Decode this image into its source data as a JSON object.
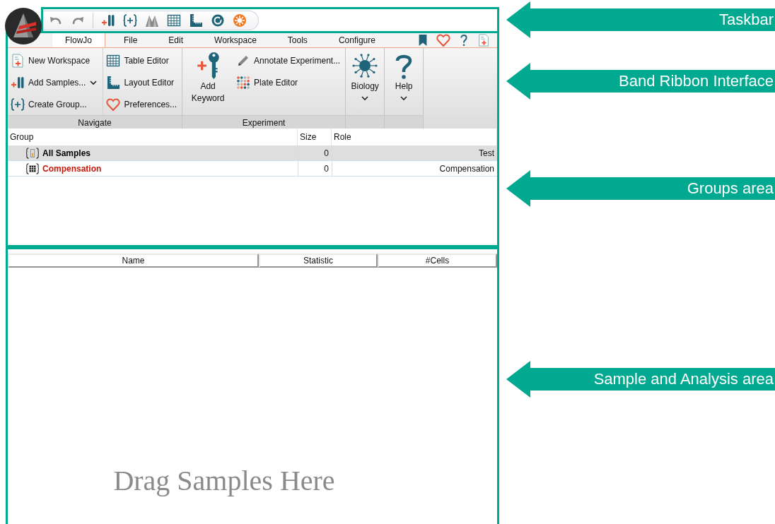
{
  "menu_tabs": [
    {
      "label": "FlowJo",
      "selected": true
    },
    {
      "label": "File",
      "selected": false
    },
    {
      "label": "Edit",
      "selected": false
    },
    {
      "label": "Workspace",
      "selected": false
    },
    {
      "label": "Tools",
      "selected": false
    },
    {
      "label": "Configure",
      "selected": false
    }
  ],
  "ribbon": {
    "sections": [
      {
        "title": "Navigate",
        "columns": [
          [
            {
              "label": "New Workspace",
              "kind": "newdoc",
              "dropdown": false
            },
            {
              "label": "Add Samples...",
              "kind": "tubes",
              "dropdown": true
            },
            {
              "label": "Create Group...",
              "kind": "braces",
              "dropdown": false
            }
          ],
          [
            {
              "label": "Table Editor",
              "kind": "grid",
              "dropdown": false
            },
            {
              "label": "Layout Editor",
              "kind": "ruler",
              "dropdown": false
            },
            {
              "label": "Preferences...",
              "kind": "heart",
              "dropdown": false
            }
          ]
        ]
      },
      {
        "title": "Experiment",
        "large": [
          {
            "label": "Add Keyword",
            "kind": "key",
            "dropdown": false
          }
        ],
        "columns": [
          [
            {
              "label": "Annotate Experiment...",
              "kind": "pencil",
              "dropdown": false
            },
            {
              "label": "Plate Editor",
              "kind": "plate",
              "dropdown": false
            }
          ]
        ]
      },
      {
        "large": [
          {
            "label": "Biology",
            "kind": "virus",
            "dropdown": true
          }
        ]
      },
      {
        "large": [
          {
            "label": "Help",
            "kind": "question",
            "dropdown": true
          }
        ]
      }
    ]
  },
  "groups_table": {
    "columns": [
      "Group",
      "Size",
      "Role"
    ],
    "rows": [
      {
        "kind": "tube",
        "name": "All Samples",
        "size": "0",
        "role": "Test",
        "selected": true,
        "color": "#000000"
      },
      {
        "kind": "grid",
        "name": "Compensation",
        "size": "0",
        "role": "Compensation",
        "selected": false,
        "color": "#c41a0c"
      }
    ]
  },
  "analysis_table": {
    "columns": [
      "Name",
      "Statistic",
      "#Cells"
    ],
    "empty_message": "Drag Samples Here"
  },
  "annotations": [
    {
      "label": "Taskbar"
    },
    {
      "label": "Band Ribbon Interface"
    },
    {
      "label": "Groups area"
    },
    {
      "label": "Sample and Analysis area"
    }
  ]
}
